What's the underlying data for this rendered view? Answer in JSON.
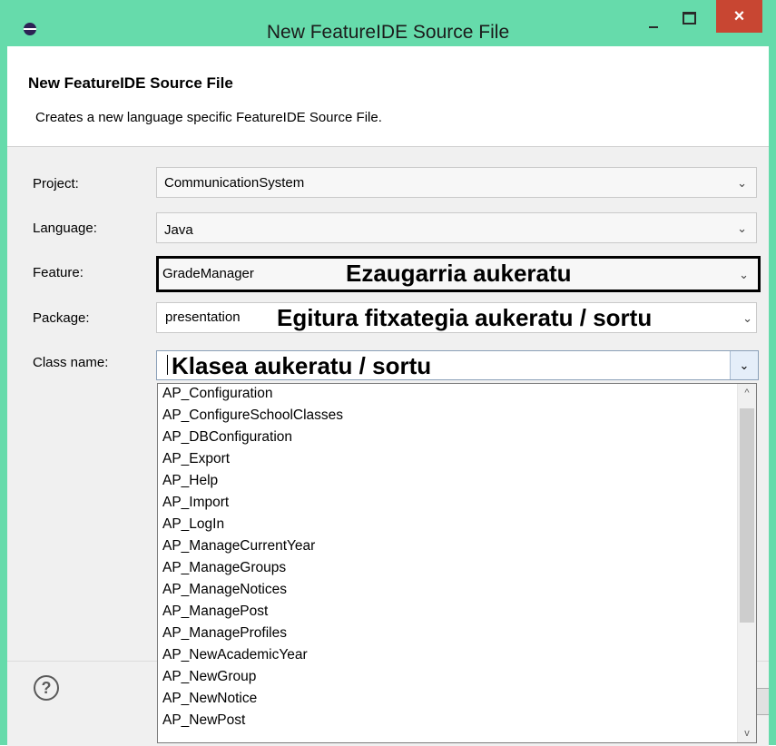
{
  "window": {
    "title": "New FeatureIDE Source File",
    "controls": {
      "minimize": "minimize",
      "maximize": "maximize",
      "close": "×"
    },
    "accent_color": "#66dbab",
    "close_color": "#c84632"
  },
  "header": {
    "title": "New FeatureIDE Source File",
    "description": "Creates a new language specific FeatureIDE Source File."
  },
  "form": {
    "project": {
      "label": "Project:",
      "value": "CommunicationSystem"
    },
    "language": {
      "label": "Language:",
      "value": "Java"
    },
    "feature": {
      "label": "Feature:",
      "value": "GradeManager",
      "annotation": "Ezaugarria aukeratu"
    },
    "package": {
      "label": "Package:",
      "value": "presentation",
      "annotation": "Egitura fitxategia aukeratu / sortu"
    },
    "class_name": {
      "label": "Class name:",
      "value": "",
      "annotation": "Klasea aukeratu / sortu"
    }
  },
  "class_dropdown": {
    "items": [
      "AP_Configuration",
      "AP_ConfigureSchoolClasses",
      "AP_DBConfiguration",
      "AP_Export",
      "AP_Help",
      "AP_Import",
      "AP_LogIn",
      "AP_ManageCurrentYear",
      "AP_ManageGroups",
      "AP_ManageNotices",
      "AP_ManagePost",
      "AP_ManageProfiles",
      "AP_NewAcademicYear",
      "AP_NewGroup",
      "AP_NewNotice",
      "AP_NewPost"
    ]
  },
  "icons": {
    "app": "featureide-eclipse-icon",
    "combo_arrow": "chevron-down-icon",
    "help": "help-icon"
  },
  "glyphs": {
    "chevron": "⌄",
    "scroll_up": "^",
    "scroll_down": "v",
    "help": "?"
  }
}
